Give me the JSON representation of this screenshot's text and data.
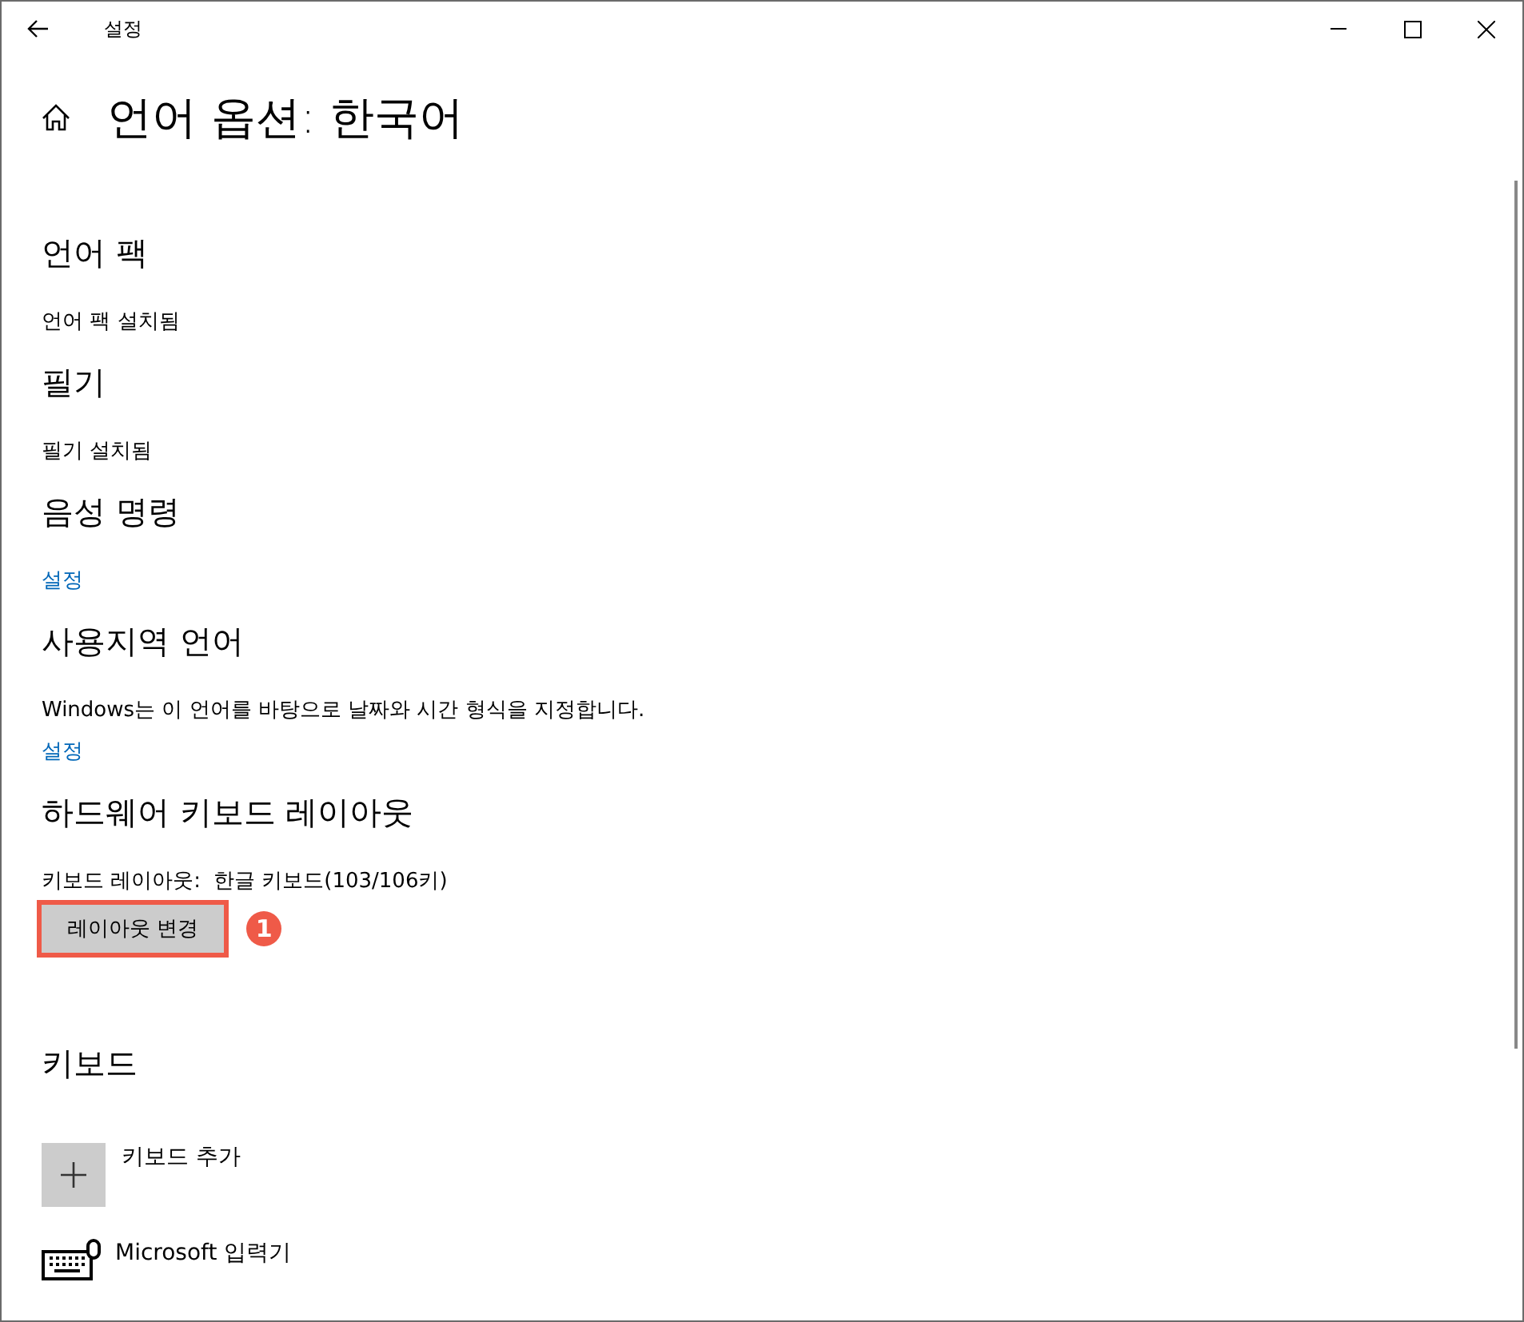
{
  "window": {
    "title": "설정"
  },
  "page": {
    "title": "언어 옵션: 한국어"
  },
  "sections": [
    {
      "heading": "언어 팩",
      "items": [
        {
          "kind": "text",
          "text": "언어 팩 설치됨"
        }
      ]
    },
    {
      "heading": "필기",
      "items": [
        {
          "kind": "text",
          "text": "필기 설치됨"
        }
      ]
    },
    {
      "heading": "음성 명령",
      "items": [
        {
          "kind": "link",
          "text": "설정"
        }
      ]
    },
    {
      "heading": "사용지역 언어",
      "items": [
        {
          "kind": "text",
          "text": "Windows는 이 언어를 바탕으로 날짜와 시간 형식을 지정합니다."
        },
        {
          "kind": "link",
          "text": "설정"
        }
      ]
    },
    {
      "heading": "하드웨어 키보드 레이아웃",
      "items": [
        {
          "kind": "pair",
          "label": "키보드 레이아웃:",
          "value": "한글 키보드(103/106키)"
        },
        {
          "kind": "button",
          "text": "레이아웃 변경",
          "highlighted": true,
          "badge": "1"
        }
      ]
    },
    {
      "heading": "키보드",
      "items": [
        {
          "kind": "add",
          "text": "키보드 추가"
        },
        {
          "kind": "keyboard",
          "text": "Microsoft 입력기"
        }
      ]
    }
  ]
}
